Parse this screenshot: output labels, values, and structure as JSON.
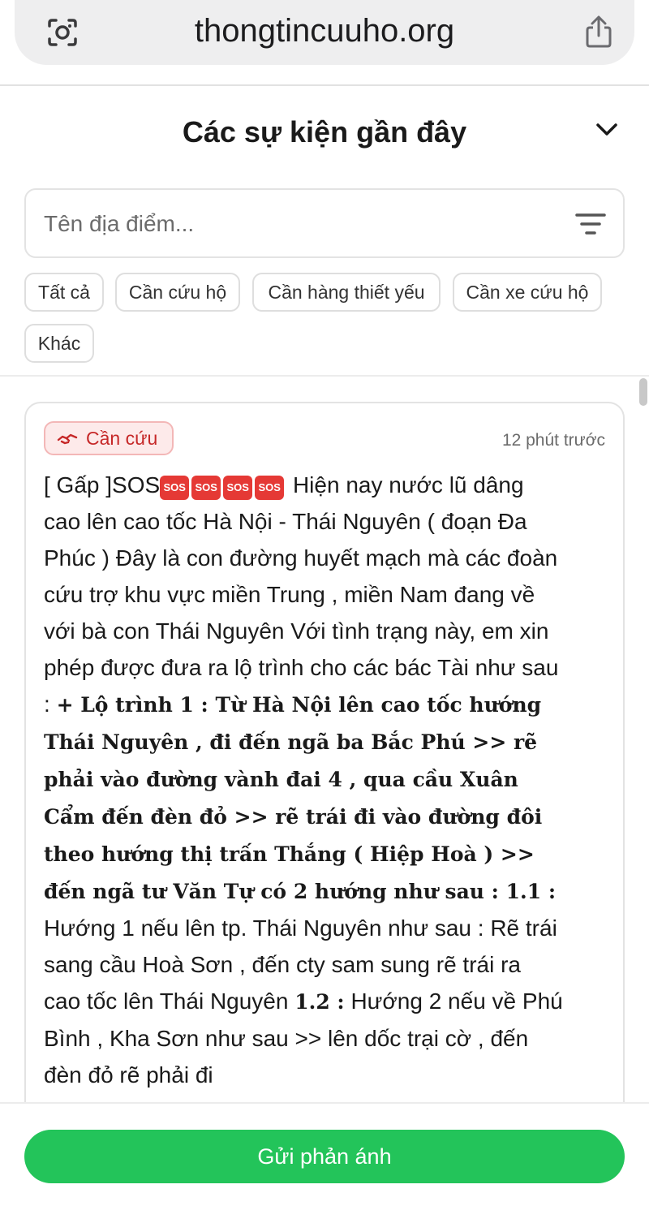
{
  "browser": {
    "url": "thongtincuuho.org"
  },
  "header": {
    "title": "Các sự kiện gần đây"
  },
  "search": {
    "placeholder": "Tên địa điểm..."
  },
  "filters": [
    {
      "label": "Tất cả"
    },
    {
      "label": "Cần cứu hộ"
    },
    {
      "label": "Cần hàng thiết yếu"
    },
    {
      "label": "Cần xe cứu hộ"
    },
    {
      "label": "Khác"
    }
  ],
  "post": {
    "badge": "Cần cứu",
    "time": "12 phút trước",
    "sos_label": "SOS",
    "text_intro": "[ Gấp ]SOS",
    "text_main": " Hiện nay nước lũ dâng cao lên cao tốc Hà Nội - Thái Nguyên ( đoạn Đa Phúc ) Đây là con đường huyết mạch mà các đoàn cứu trợ khu vực miền Trung , miền Nam đang về với bà con Thái Nguyên Với tình trạng này, em xin phép được đưa ra lộ trình cho các bác Tài như sau : ",
    "text_bold": "+ Lộ trình 1 : Từ Hà Nội lên cao tốc hướng Thái Nguyên , đi đến ngã ba Bắc Phú >> rẽ phải vào đường vành đai 4 , qua cầu Xuân Cẩm đến đèn đỏ >> rẽ trái đi vào đường đôi theo hướng thị trấn Thắng ( Hiệp Hoà ) >> đến ngã tư Văn Tự có 2 hướng như sau : 1.1 :",
    "text_rest1": " Hướng 1 nếu lên tp. Thái Nguyên như sau : Rẽ trái sang cầu Hoà Sơn , đến cty sam sung rẽ trái ra cao tốc lên Thái Nguyên ",
    "text_bold2": "1.2 :",
    "text_rest2": " Hướng 2 nếu về Phú Bình , Kha Sơn như sau >> lên dốc trại cờ , đến đèn đỏ rẽ phải đi"
  },
  "footer": {
    "submit_label": "Gửi phản ánh"
  },
  "colors": {
    "accent": "#23c45a",
    "badge_text": "#c62828",
    "badge_bg": "#fdeaea",
    "sos": "#e53935"
  }
}
